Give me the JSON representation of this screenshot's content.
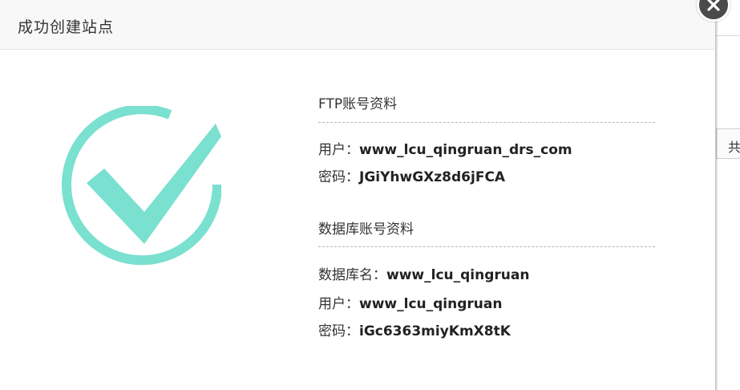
{
  "dialog": {
    "title": "成功创建站点"
  },
  "ftp": {
    "section_title": "FTP账号资料",
    "user_label": "用户：",
    "user_value": "www_lcu_qingruan_drs_com",
    "password_label": "密码：",
    "password_value": "JGiYhwGXz8d6jFCA"
  },
  "database": {
    "section_title": "数据库账号资料",
    "name_label": "数据库名：",
    "name_value": "www_lcu_qingruan",
    "user_label": "用户：",
    "user_value": "www_lcu_qingruan",
    "password_label": "密码：",
    "password_value": "iGc6363miyKmX8tK"
  },
  "background": {
    "partial_text": "共"
  },
  "colors": {
    "success": "#7ae0cf",
    "close_button": "#4a4a4a"
  },
  "icons": {
    "success": "check-circle-icon",
    "close": "close-icon"
  }
}
